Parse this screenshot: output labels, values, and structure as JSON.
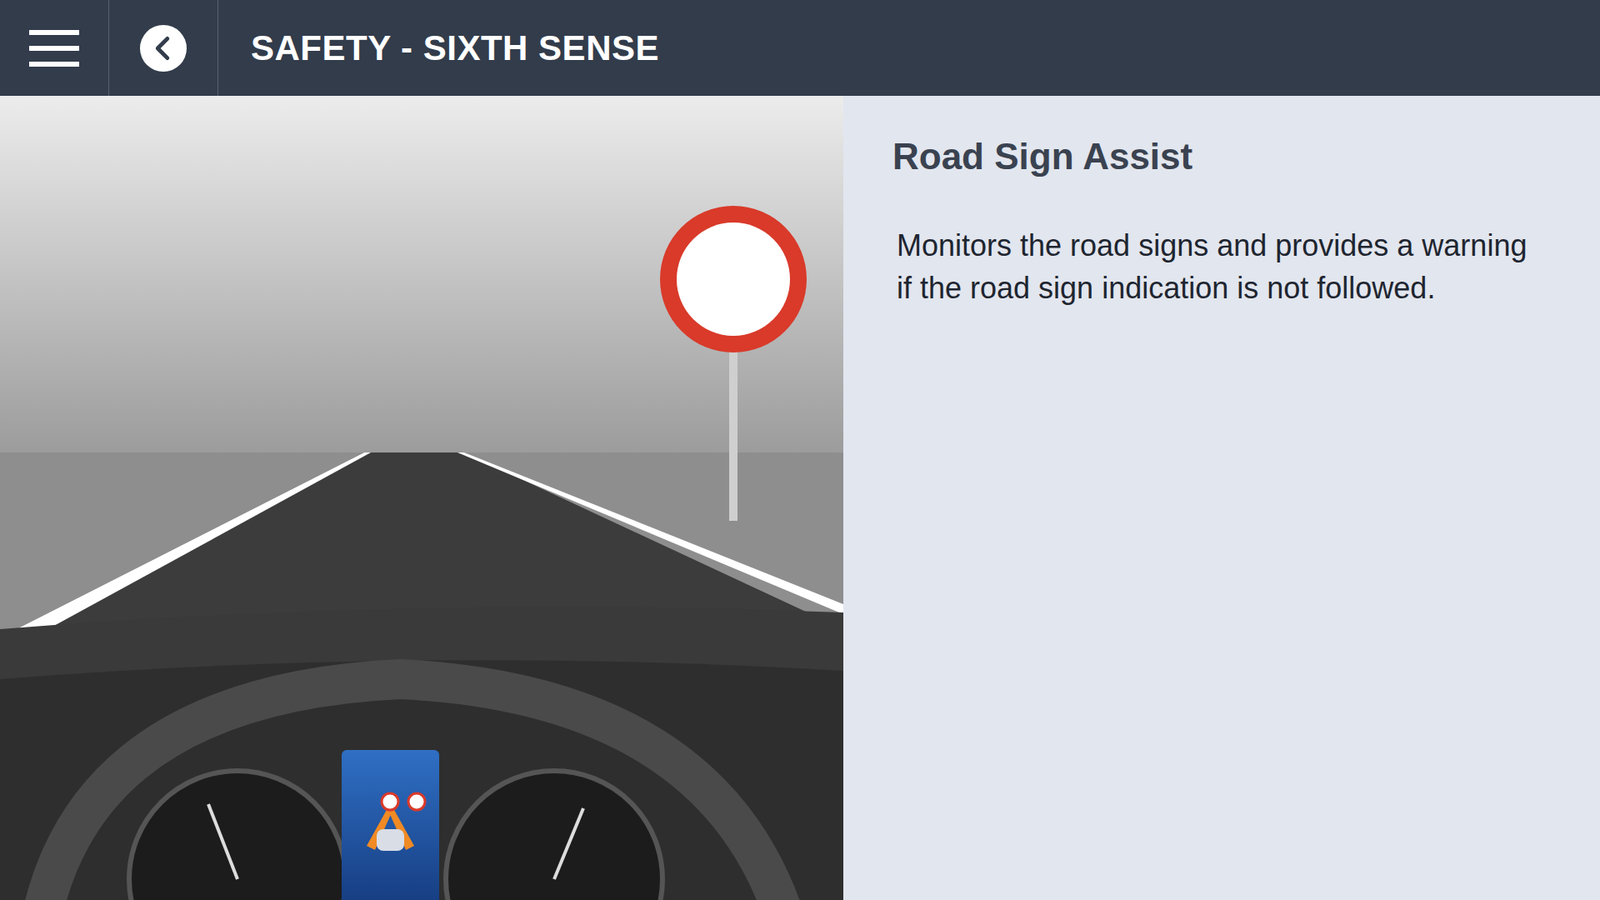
{
  "header": {
    "title": "SAFETY - SIXTH SENSE"
  },
  "feature": {
    "title": "Road Sign Assist",
    "description": "Monitors the road signs and provides a warning if the road sign indication is not followed."
  }
}
